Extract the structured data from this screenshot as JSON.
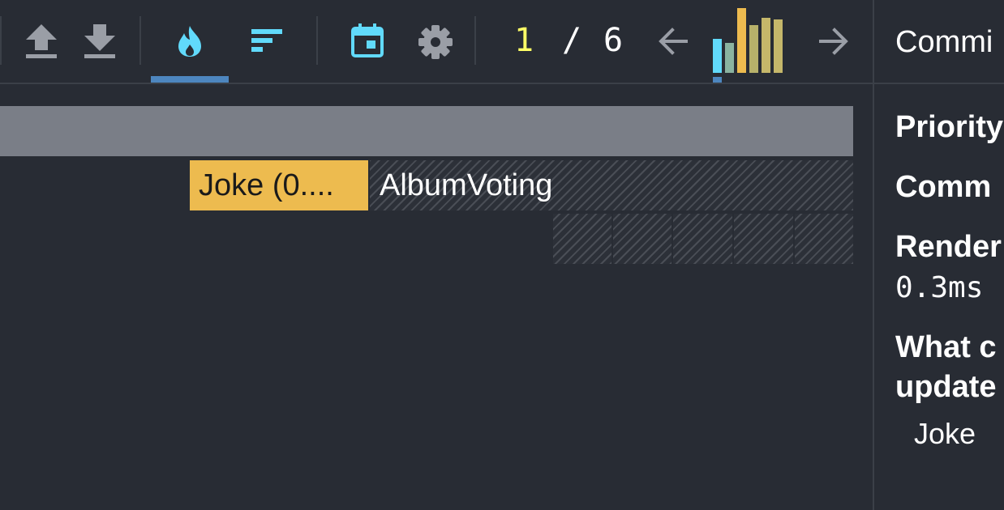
{
  "toolbar": {
    "icons": [
      "upload-icon",
      "download-icon",
      "flame-icon",
      "ranked-icon",
      "calendar-icon",
      "gear-icon"
    ],
    "selected_tab": "flame-chart",
    "commit_index": "1",
    "commit_separator": "/",
    "commit_total": "6",
    "prev_icon": "arrow-left-icon",
    "next_icon": "arrow-right-icon",
    "colors": {
      "active_icon": "#61dafb",
      "inactive_icon": "#9a9ea6",
      "tab_indicator": "#4d86bf",
      "current_commit": "#ffff66"
    }
  },
  "commit_bars": {
    "selected": 0,
    "levels": [
      0.52,
      0.46,
      1.0,
      0.74,
      0.85,
      0.82
    ],
    "colors": [
      "#61dafb",
      "#8ab3a0",
      "#edbb4f",
      "#b7b16a",
      "#c5b76a",
      "#c5b76a"
    ]
  },
  "flame_chart": {
    "root_bar_color": "#7a7e87",
    "nodes": [
      {
        "label": "Joke (0....",
        "color": "#edbb4f"
      },
      {
        "label": "AlbumVoting"
      }
    ]
  },
  "panel": {
    "title": "Commi",
    "priority_label": "Priority",
    "committed_label": "Comm",
    "render_label": "Render",
    "render_value": "0.3ms",
    "what_changed_line1": "What c",
    "what_changed_line2": "update",
    "updater": "Joke"
  }
}
